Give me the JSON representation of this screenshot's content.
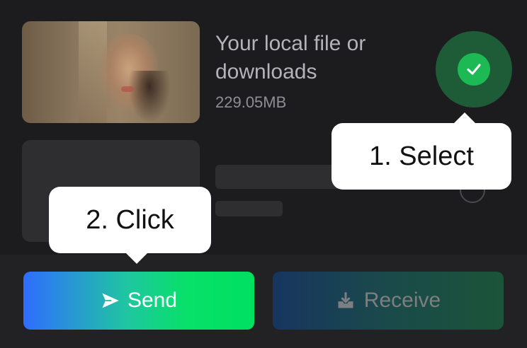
{
  "file_item": {
    "title": "Your local file or downloads",
    "size": "229.05MB",
    "selected": true
  },
  "tooltips": {
    "select": "1. Select",
    "click": "2. Click"
  },
  "actions": {
    "send_label": "Send",
    "receive_label": "Receive",
    "send_icon": "paper-plane-icon",
    "receive_icon": "download-tray-icon"
  },
  "colors": {
    "accent_green": "#1db954",
    "send_gradient_start": "#2f6dff",
    "send_gradient_end": "#00e060"
  }
}
